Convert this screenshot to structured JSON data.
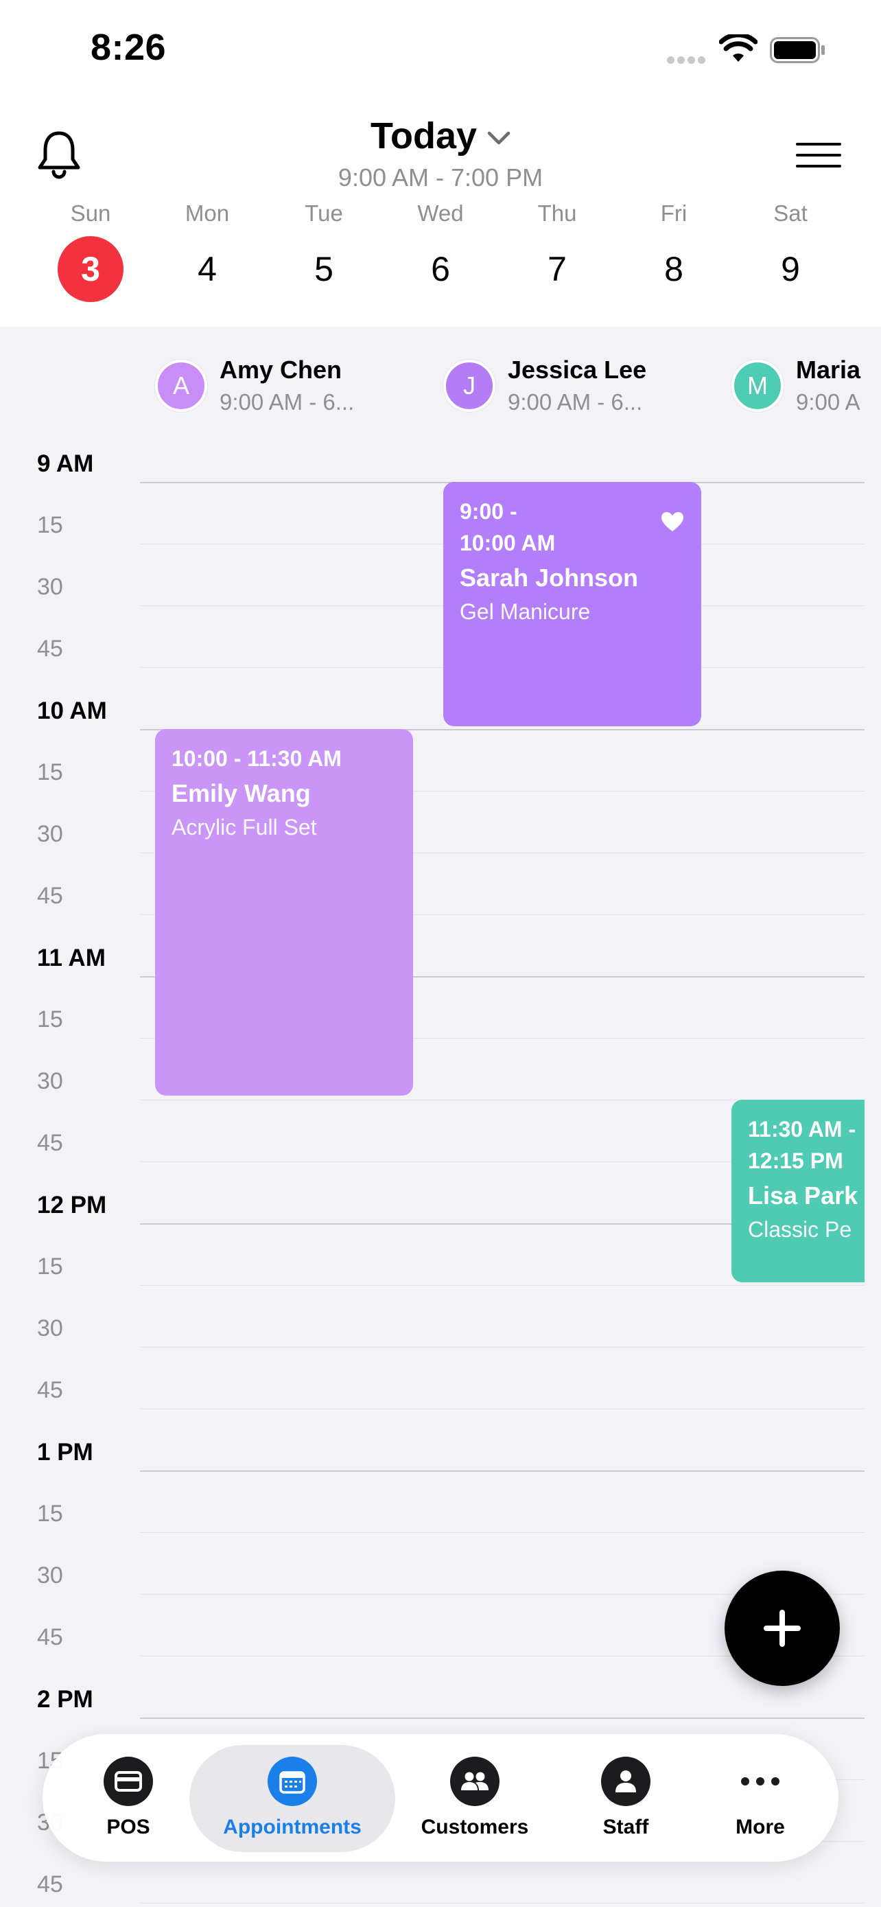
{
  "status_bar": {
    "time": "8:26"
  },
  "header": {
    "date_title": "Today",
    "hours": "9:00 AM - 7:00 PM",
    "week": [
      {
        "day": "Sun",
        "date": "3",
        "selected": true
      },
      {
        "day": "Mon",
        "date": "4"
      },
      {
        "day": "Tue",
        "date": "5"
      },
      {
        "day": "Wed",
        "date": "6"
      },
      {
        "day": "Thu",
        "date": "7"
      },
      {
        "day": "Fri",
        "date": "8"
      },
      {
        "day": "Sat",
        "date": "9"
      }
    ]
  },
  "staff": [
    {
      "initial": "A",
      "name": "Amy Chen",
      "hours": "9:00 AM - 6...",
      "color": "#c98df7"
    },
    {
      "initial": "J",
      "name": "Jessica Lee",
      "hours": "9:00 AM - 6...",
      "color": "#b47cf5"
    },
    {
      "initial": "M",
      "name": "Maria",
      "hours": "9:00 A",
      "color": "#4ecdb4"
    }
  ],
  "time_labels": [
    "9 AM",
    "15",
    "30",
    "45",
    "10 AM",
    "15",
    "30",
    "45",
    "11 AM",
    "15",
    "30",
    "45",
    "12 PM",
    "15",
    "30",
    "45",
    "1 PM",
    "15",
    "30",
    "45",
    "2 PM",
    "15",
    "30",
    "45"
  ],
  "appointments": [
    {
      "time": "10:00 - 11:30 AM",
      "client": "Emily Wang",
      "service": "Acrylic Full Set",
      "color": "#c996f8"
    },
    {
      "time_line1": "9:00 -",
      "time_line2": "10:00 AM",
      "client": "Sarah Johnson",
      "service": "Gel Manicure",
      "color": "#b27efb",
      "favorite": true
    },
    {
      "time_line1": "11:30 AM -",
      "time_line2": "12:15 PM",
      "client": "Lisa Park",
      "service": "Classic Pe",
      "color": "#4ecbb2"
    }
  ],
  "tabs": [
    {
      "label": "POS",
      "icon": "card-icon"
    },
    {
      "label": "Appointments",
      "icon": "calendar-icon",
      "active": true
    },
    {
      "label": "Customers",
      "icon": "people-icon"
    },
    {
      "label": "Staff",
      "icon": "person-icon"
    },
    {
      "label": "More",
      "icon": "ellipsis-icon"
    }
  ],
  "colors": {
    "accent": "#1a7fe8",
    "today": "#f2333f"
  }
}
